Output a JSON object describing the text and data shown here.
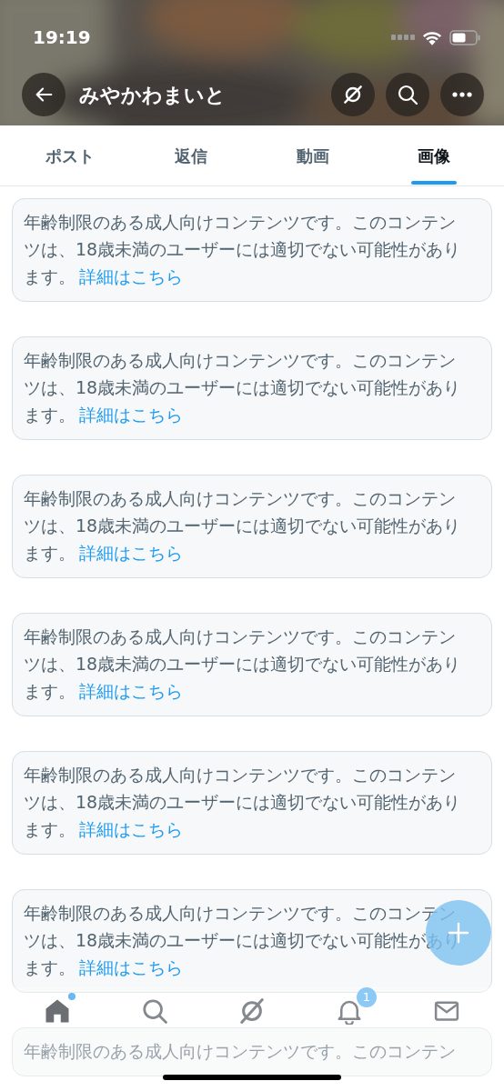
{
  "status_bar": {
    "time": "19:19"
  },
  "header": {
    "title": "みやかわまいと"
  },
  "tabs": [
    {
      "label": "ポスト",
      "selected": false
    },
    {
      "label": "返信",
      "selected": false
    },
    {
      "label": "動画",
      "selected": false
    },
    {
      "label": "画像",
      "selected": true
    }
  ],
  "posts": [
    {
      "text": "年齢制限のある成人向けコンテンツです。このコンテンツは、18歳未満のユーザーには適切でない可能性があります。",
      "link": "詳細はこちら"
    },
    {
      "text": "年齢制限のある成人向けコンテンツです。このコンテンツは、18歳未満のユーザーには適切でない可能性があります。",
      "link": "詳細はこちら"
    },
    {
      "text": "年齢制限のある成人向けコンテンツです。このコンテンツは、18歳未満のユーザーには適切でない可能性があります。",
      "link": "詳細はこちら"
    },
    {
      "text": "年齢制限のある成人向けコンテンツです。このコンテンツは、18歳未満のユーザーには適切でない可能性があります。",
      "link": "詳細はこちら"
    },
    {
      "text": "年齢制限のある成人向けコンテンツです。このコンテンツは、18歳未満のユーザーには適切でない可能性があります。",
      "link": "詳細はこちら"
    },
    {
      "text": "年齢制限のある成人向けコンテンツです。このコンテンツは、18歳未満のユーザーには適切でない可能性があります。",
      "link": "詳細はこちら"
    },
    {
      "text": "年齢制限のある成人向けコンテンツです。このコンテン"
    }
  ],
  "bottom_nav": [
    {
      "kind": "home",
      "selected": true,
      "dot": true
    },
    {
      "kind": "search",
      "selected": false,
      "dot": false
    },
    {
      "kind": "spaces",
      "selected": false,
      "dot": false
    },
    {
      "kind": "notifications",
      "selected": false,
      "dot": false,
      "badge": "1"
    },
    {
      "kind": "messages",
      "selected": false,
      "dot": false
    }
  ]
}
